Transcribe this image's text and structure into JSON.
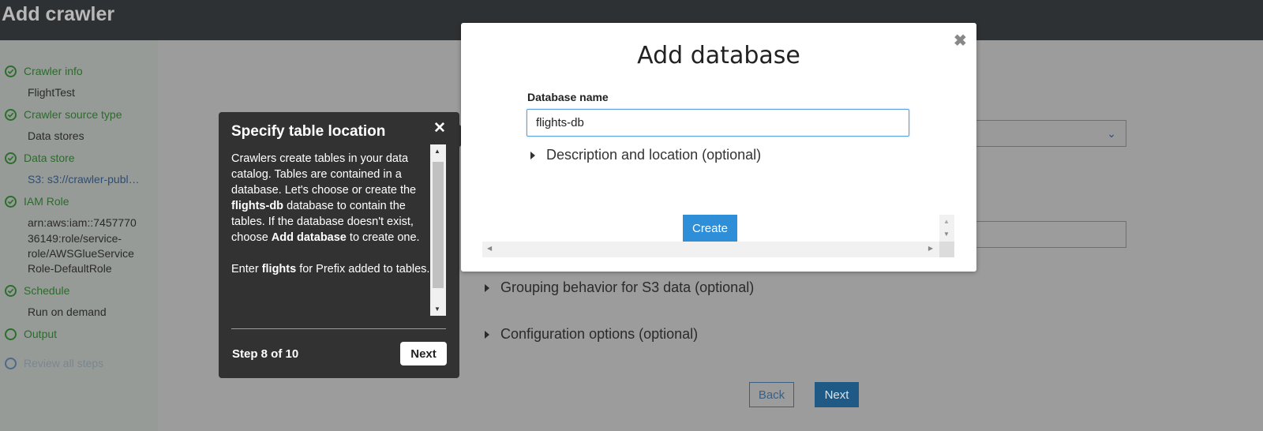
{
  "page": {
    "title": "Add crawler"
  },
  "sidebar": {
    "steps": [
      {
        "label": "Crawler info",
        "detail": [
          "FlightTest"
        ]
      },
      {
        "label": "Crawler source type",
        "detail": [
          "Data stores"
        ]
      },
      {
        "label": "Data store",
        "detail": [
          "S3: s3://crawler-publ…"
        ]
      },
      {
        "label": "IAM Role",
        "detail": [
          "arn:aws:iam::7457770",
          "36149:role/service-",
          "role/AWSGlueService",
          "Role-DefaultRole"
        ]
      },
      {
        "label": "Schedule",
        "detail": [
          "Run on demand"
        ]
      },
      {
        "label": "Output",
        "detail": []
      },
      {
        "label": "Review all steps",
        "detail": []
      }
    ]
  },
  "main": {
    "expanders": {
      "grouping": "Grouping behavior for S3 data (optional)",
      "configuration": "Configuration options (optional)"
    },
    "back_label": "Back",
    "next_label": "Next"
  },
  "tour": {
    "title": "Specify table location",
    "close_glyph": "✕",
    "paragraph1": {
      "a": "Crawlers create tables in your data catalog. Tables are contained in a database. Let's choose or create the ",
      "b": "flights-db",
      "c": " database to contain the tables. If the database doesn't exist, choose ",
      "d": "Add database",
      "e": " to create one."
    },
    "paragraph2": {
      "a": "Enter ",
      "b": "flights",
      "c": " for Prefix added to tables."
    },
    "step_text": "Step 8 of 10",
    "next_label": "Next"
  },
  "modal": {
    "title": "Add database",
    "close_glyph": "✖",
    "field_label": "Database name",
    "database_name_value": "flights-db",
    "expander_label": "Description and location (optional)",
    "create_label": "Create"
  },
  "colors": {
    "topbar": "#2e3133",
    "success_green": "#2b6b2b",
    "primary_blue": "#2e8fd8",
    "tooltip_bg": "#323232"
  }
}
